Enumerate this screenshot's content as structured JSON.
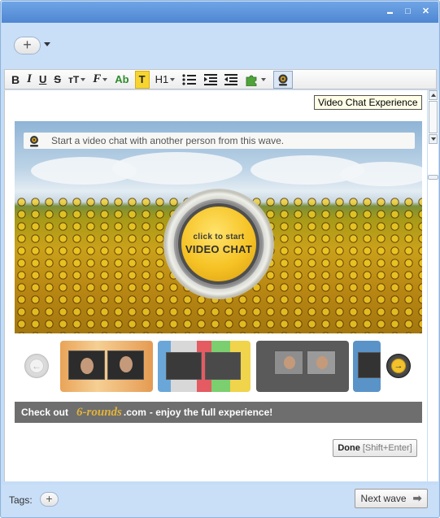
{
  "window": {
    "controls": [
      "minimize-icon",
      "maximize-icon",
      "close-icon"
    ],
    "minimize_glyph": "▬",
    "maximize_glyph": "□",
    "close_glyph": "✕"
  },
  "wave_header": {
    "add_glyph": "+"
  },
  "toolbar": {
    "bold": "B",
    "italic": "I",
    "underline": "U",
    "strikethrough": "S",
    "font_size": "тT",
    "font_family": "F",
    "text_color": "Ab",
    "highlight": "T",
    "heading": "H1",
    "video_chat_tooltip": "Video Chat Experience"
  },
  "video_gadget": {
    "prompt": "Start a video chat with another person from this wave.",
    "start_small": "click to start",
    "start_big": "VIDEO CHAT",
    "prev_glyph": "←",
    "next_glyph": "→"
  },
  "promo": {
    "prefix": "Check out",
    "logo": "6-rounds",
    "domain": ".com",
    "suffix": "- enjoy the full experience!"
  },
  "editor": {
    "done_label": "Done",
    "done_hint": "[Shift+Enter]"
  },
  "footer": {
    "tags_label": "Tags:",
    "tags_add_glyph": "+",
    "next_wave_label": "Next wave",
    "next_wave_glyph": "➡"
  },
  "colors": {
    "titlebar": "#5b92d9",
    "frame": "#c9def7",
    "accent_yellow": "#f6c325",
    "promo_bar": "#6e6e6e"
  }
}
